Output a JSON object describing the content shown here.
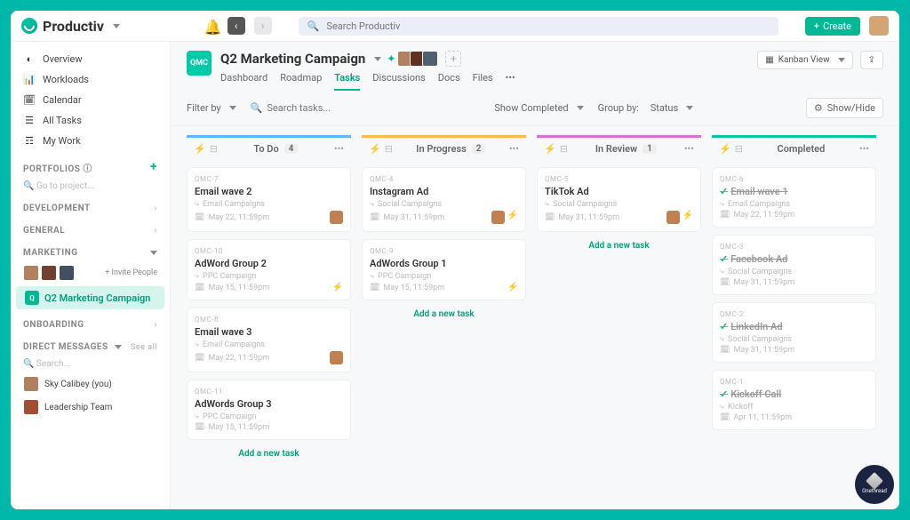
{
  "brand": "Productiv",
  "search": {
    "placeholder": "Search Productiv"
  },
  "create_label": "Create",
  "nav": {
    "items": [
      "Overview",
      "Workloads",
      "Calendar",
      "All Tasks",
      "My Work"
    ]
  },
  "portfolios_label": "PORTFOLIOS",
  "portfolio_placeholder": "Go to project...",
  "sections": [
    "DEVELOPMENT",
    "GENERAL",
    "MARKETING",
    "ONBOARDING"
  ],
  "invite_label": "+ Invite People",
  "project_item": "Q2 Marketing Campaign",
  "dm_label": "DIRECT MESSAGES",
  "dm_see_all": "See all",
  "dm_search": "Search...",
  "dms": [
    "Sky Calibey (you)",
    "Leadership Team"
  ],
  "project": {
    "badge": "QMC",
    "title": "Q2 Marketing Campaign",
    "tabs": [
      "Dashboard",
      "Roadmap",
      "Tasks",
      "Discussions",
      "Docs",
      "Files"
    ],
    "active_tab": 2
  },
  "kanban_label": "Kanban View",
  "toolbar": {
    "filter": "Filter by",
    "search_placeholder": "Search tasks...",
    "show_completed": "Show Completed",
    "group_by": "Group by:",
    "group_val": "Status",
    "show_hide": "Show/Hide"
  },
  "add_task_label": "Add a new task",
  "columns": [
    {
      "key": "todo",
      "title": "To Do",
      "count": 4,
      "cards": [
        {
          "id": "QMC-7",
          "title": "Email wave 2",
          "tag": "Email Campaigns",
          "date": "May 22, 11:59pm",
          "av": true
        },
        {
          "id": "QMC-10",
          "title": "AdWord Group 2",
          "tag": "PPC Campaign",
          "date": "May 15, 11:59pm",
          "flash": true
        },
        {
          "id": "QMC-8",
          "title": "Email wave 3",
          "tag": "Email Campaigns",
          "date": "May 22, 11:59pm",
          "av": true
        },
        {
          "id": "QMC-11",
          "title": "AdWords Group 3",
          "tag": "PPC Campaign",
          "date": "May 15, 11:59pm"
        }
      ]
    },
    {
      "key": "progress",
      "title": "In Progress",
      "count": 2,
      "cards": [
        {
          "id": "QMC-4",
          "title": "Instagram Ad",
          "tag": "Social Campaigns",
          "date": "May 31, 11:59pm",
          "av": true,
          "flash": true
        },
        {
          "id": "QMC-9",
          "title": "AdWords Group 1",
          "tag": "PPC Campaign",
          "date": "May 15, 11:59pm",
          "flash": true
        }
      ]
    },
    {
      "key": "review",
      "title": "In Review",
      "count": 1,
      "cards": [
        {
          "id": "QMC-5",
          "title": "TikTok Ad",
          "tag": "Social Campaigns",
          "date": "May 31, 11:59pm",
          "av": true,
          "flash": true
        }
      ]
    },
    {
      "key": "done",
      "title": "Completed",
      "count": "",
      "cards": [
        {
          "id": "QMC-6",
          "title": "Email wave 1",
          "tag": "Email Campaigns",
          "date": "May 22, 11:59pm",
          "done": true
        },
        {
          "id": "QMC-3",
          "title": "Facebook Ad",
          "tag": "Social Campaigns",
          "date": "May 31, 11:59pm",
          "done": true
        },
        {
          "id": "QMC-2",
          "title": "LinkedIn Ad",
          "tag": "Social Campaigns",
          "date": "May 31, 11:59pm",
          "done": true
        },
        {
          "id": "QMC-1",
          "title": "Kickoff Call",
          "tag": "Kickoff",
          "date": "Apr 11, 11:59pm",
          "done": true
        }
      ]
    }
  ],
  "badge_brand": "Onethread"
}
